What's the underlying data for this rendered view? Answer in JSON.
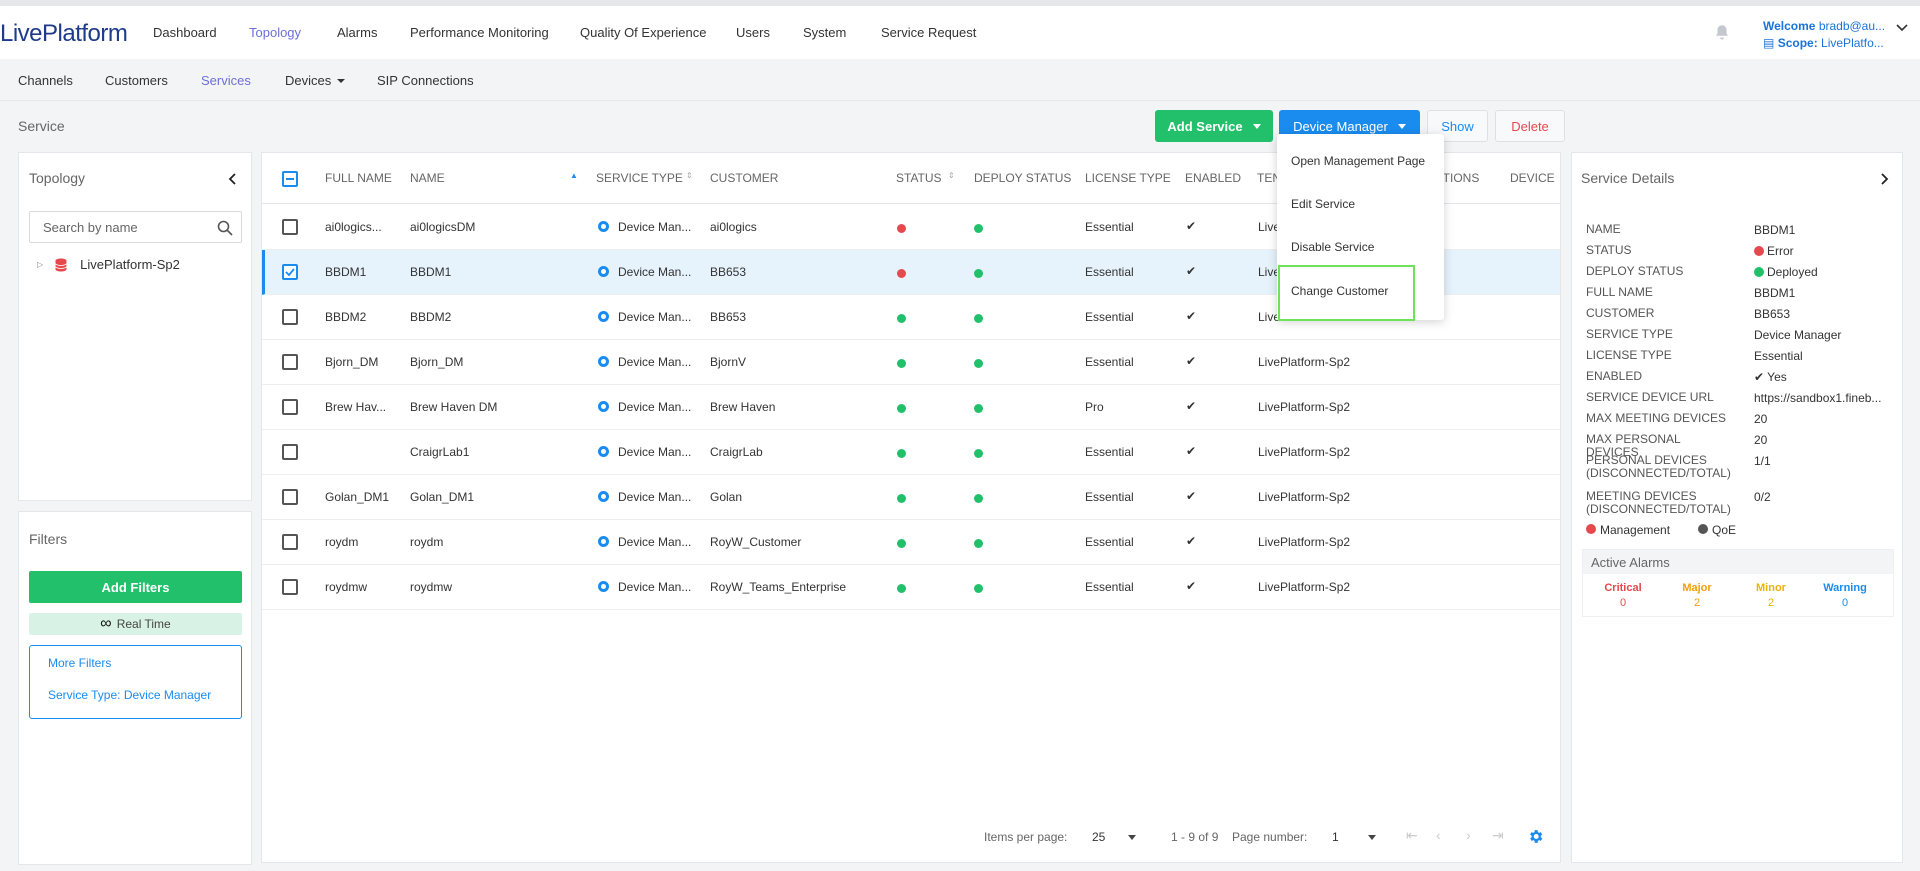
{
  "app": {
    "logo_text": "LivePlatform"
  },
  "topnav": {
    "items": [
      "Dashboard",
      "Topology",
      "Alarms",
      "Performance Monitoring",
      "Quality Of Experience",
      "Users",
      "System",
      "Service Request"
    ],
    "active": "Topology",
    "welcome_label": "Welcome",
    "welcome_user": "bradb@au...",
    "scope_label": "Scope:",
    "scope_value": "LivePlatfo..."
  },
  "subnav": {
    "items": [
      "Channels",
      "Customers",
      "Services",
      "Devices",
      "SIP Connections"
    ],
    "active": "Services"
  },
  "page": {
    "title": "Service"
  },
  "actions": {
    "add_service": "Add Service",
    "device_manager": "Device Manager",
    "show": "Show",
    "delete": "Delete"
  },
  "dropdown": {
    "items": [
      "Open Management Page",
      "Edit Service",
      "Disable Service",
      "Change Customer"
    ]
  },
  "topology": {
    "title": "Topology",
    "search_placeholder": "Search by name",
    "tree_root": "LivePlatform-Sp2"
  },
  "filters": {
    "title": "Filters",
    "add_filters": "Add Filters",
    "real_time": "Real Time",
    "more_filters": "More Filters",
    "active_filter": "Service Type: Device Manager"
  },
  "table": {
    "columns": [
      "FULL NAME",
      "NAME",
      "SERVICE TYPE",
      "CUSTOMER",
      "STATUS",
      "DEPLOY STATUS",
      "LICENSE TYPE",
      "ENABLED",
      "TEN",
      "ECTIONS",
      "DEVICE"
    ],
    "rows": [
      {
        "full_name": "ai0logics...",
        "name": "ai0logicsDM",
        "service_type": "Device Man...",
        "customer": "ai0logics",
        "status": "red",
        "deploy": "green",
        "license": "Essential",
        "enabled": "✔",
        "tenant": "Live",
        "selected": false
      },
      {
        "full_name": "BBDM1",
        "name": "BBDM1",
        "service_type": "Device Man...",
        "customer": "BB653",
        "status": "red",
        "deploy": "green",
        "license": "Essential",
        "enabled": "✔",
        "tenant": "Live",
        "selected": true
      },
      {
        "full_name": "BBDM2",
        "name": "BBDM2",
        "service_type": "Device Man...",
        "customer": "BB653",
        "status": "green",
        "deploy": "green",
        "license": "Essential",
        "enabled": "✔",
        "tenant": "Live",
        "selected": false
      },
      {
        "full_name": "Bjorn_DM",
        "name": "Bjorn_DM",
        "service_type": "Device Man...",
        "customer": "BjornV",
        "status": "green",
        "deploy": "green",
        "license": "Essential",
        "enabled": "✔",
        "tenant": "LivePlatform-Sp2",
        "selected": false
      },
      {
        "full_name": "Brew Hav...",
        "name": "Brew Haven DM",
        "service_type": "Device Man...",
        "customer": "Brew Haven",
        "status": "green",
        "deploy": "green",
        "license": "Pro",
        "enabled": "✔",
        "tenant": "LivePlatform-Sp2",
        "selected": false
      },
      {
        "full_name": "",
        "name": "CraigrLab1",
        "service_type": "Device Man...",
        "customer": "CraigrLab",
        "status": "green",
        "deploy": "green",
        "license": "Essential",
        "enabled": "✔",
        "tenant": "LivePlatform-Sp2",
        "selected": false
      },
      {
        "full_name": "Golan_DM1",
        "name": "Golan_DM1",
        "service_type": "Device Man...",
        "customer": "Golan",
        "status": "green",
        "deploy": "green",
        "license": "Essential",
        "enabled": "✔",
        "tenant": "LivePlatform-Sp2",
        "selected": false
      },
      {
        "full_name": "roydm",
        "name": "roydm",
        "service_type": "Device Man...",
        "customer": "RoyW_Customer",
        "status": "green",
        "deploy": "green",
        "license": "Essential",
        "enabled": "✔",
        "tenant": "LivePlatform-Sp2",
        "selected": false
      },
      {
        "full_name": "roydmw",
        "name": "roydmw",
        "service_type": "Device Man...",
        "customer": "RoyW_Teams_Enterprise",
        "status": "green",
        "deploy": "green",
        "license": "Essential",
        "enabled": "✔",
        "tenant": "LivePlatform-Sp2",
        "selected": false
      }
    ]
  },
  "pager": {
    "items_per_page_label": "Items per page:",
    "items_per_page": "25",
    "range": "1 - 9 of 9",
    "page_number_label": "Page number:",
    "page_number": "1"
  },
  "details": {
    "title": "Service Details",
    "fields": [
      {
        "label": "NAME",
        "value": "BBDM1"
      },
      {
        "label": "STATUS",
        "value": "Error"
      },
      {
        "label": "DEPLOY STATUS",
        "value": "Deployed"
      },
      {
        "label": "FULL NAME",
        "value": "BBDM1"
      },
      {
        "label": "CUSTOMER",
        "value": "BB653"
      },
      {
        "label": "SERVICE TYPE",
        "value": "Device Manager"
      },
      {
        "label": "LICENSE TYPE",
        "value": "Essential"
      },
      {
        "label": "ENABLED",
        "value": "✔ Yes"
      },
      {
        "label": "SERVICE DEVICE URL",
        "value": "https://sandbox1.fineb..."
      },
      {
        "label": "MAX MEETING DEVICES",
        "value": "20"
      },
      {
        "label": "MAX PERSONAL DEVICES",
        "value": "20"
      },
      {
        "label": "PERSONAL DEVICES (DISCONNECTED/TOTAL)",
        "value": "1/1"
      },
      {
        "label": "MEETING DEVICES (DISCONNECTED/TOTAL)",
        "value": "0/2"
      }
    ],
    "legend_management": "Management",
    "legend_qoe": "QoE",
    "active_alarms": "Active Alarms",
    "alarms": [
      {
        "label": "Critical",
        "count": "0",
        "color": "#e5484d"
      },
      {
        "label": "Major",
        "count": "2",
        "color": "#f59e0b"
      },
      {
        "label": "Minor",
        "count": "2",
        "color": "#eab308"
      },
      {
        "label": "Warning",
        "count": "0",
        "color": "#1a8cf0"
      }
    ]
  },
  "colors": {
    "accent": "#1a8cf0",
    "green": "#22c06b",
    "red": "#e5484d",
    "nav_active": "#6d6fd8"
  }
}
